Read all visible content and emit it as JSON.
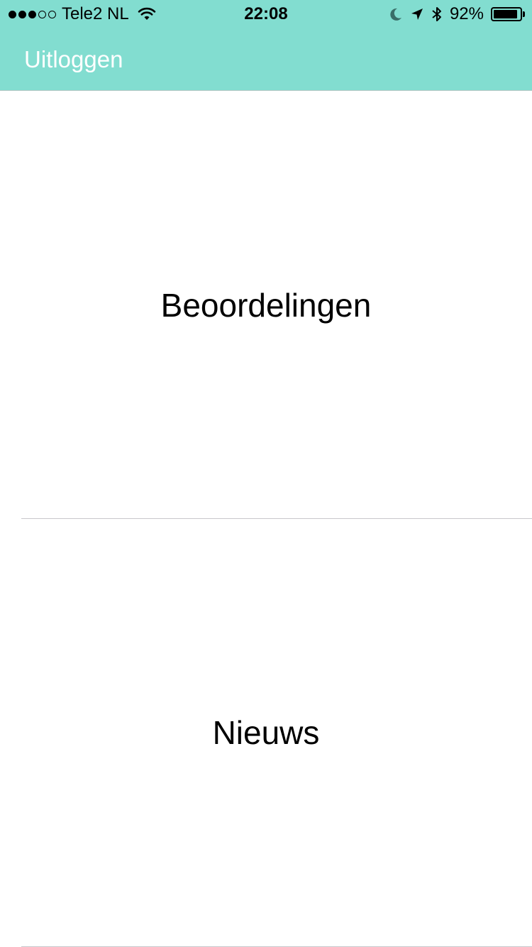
{
  "status_bar": {
    "signal_filled": 3,
    "signal_total": 5,
    "carrier": "Tele2 NL",
    "time": "22:08",
    "battery_label": "92%",
    "battery_level": 0.92,
    "icons": [
      "wifi-icon",
      "moon-icon",
      "location-arrow-icon",
      "bluetooth-icon",
      "battery-icon"
    ]
  },
  "nav": {
    "logout_label": "Uitloggen"
  },
  "menu": {
    "items": [
      {
        "label": "Beoordelingen"
      },
      {
        "label": "Nieuws"
      }
    ]
  },
  "colors": {
    "header_bg": "#82ddd0",
    "header_text": "#ffffff",
    "separator": "#c8c7cc"
  }
}
